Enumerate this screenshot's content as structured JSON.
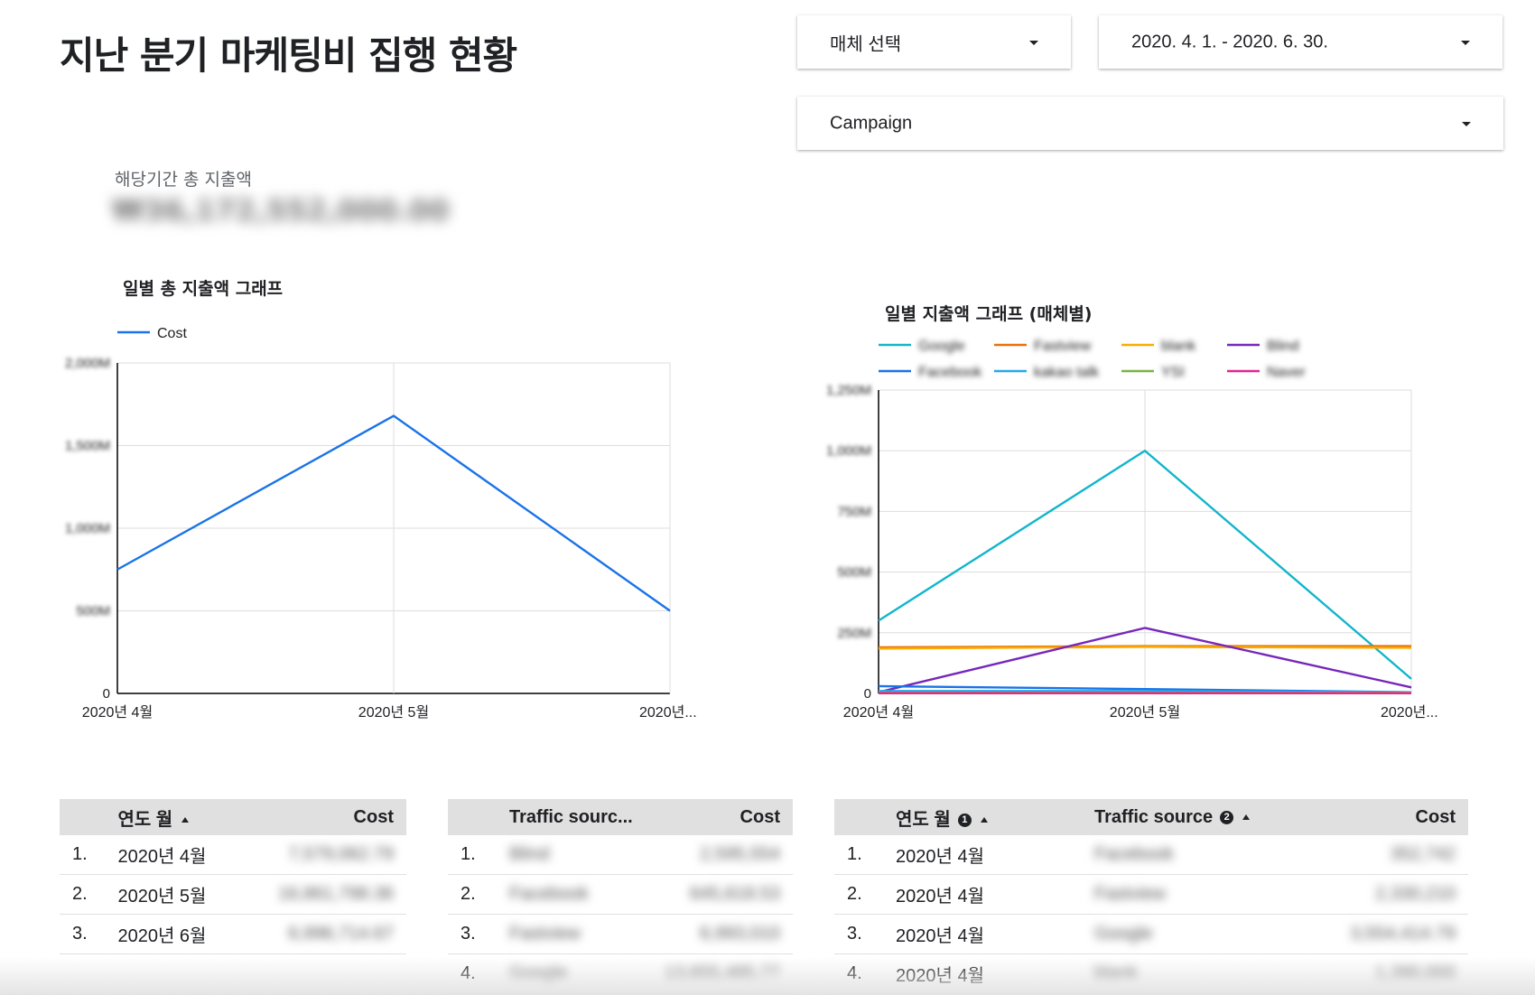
{
  "page_title": "지난 분기 마케팅비 집행 현황",
  "filters": {
    "media_select": "매체 선택",
    "date_range": "2020. 4. 1. - 2020. 6. 30.",
    "campaign": "Campaign"
  },
  "kpi": {
    "label": "해당기간 총 지출액",
    "value": "₩36,172,552,000.00"
  },
  "chart_data": [
    {
      "type": "line",
      "title": "일별 총 지출액 그래프",
      "categories": [
        "2020년 4월",
        "2020년 5월",
        "2020년..."
      ],
      "series": [
        {
          "name": "Cost",
          "color": "#1a73e8",
          "values": [
            750000000,
            1680000000,
            500000000
          ]
        }
      ],
      "y_tick_labels": [
        "0",
        "500M",
        "1,000M",
        "1,500M",
        "2,000M"
      ],
      "ylim": [
        0,
        2000000000
      ],
      "grid": true,
      "legend": "top-left"
    },
    {
      "type": "line",
      "title": "일별 지출액 그래프 (매체별)",
      "categories": [
        "2020년 4월",
        "2020년 5월",
        "2020년..."
      ],
      "series": [
        {
          "name": "Google",
          "color": "#12b5cb",
          "values": [
            300,
            1000,
            60
          ]
        },
        {
          "name": "Fastview",
          "color": "#e8710a",
          "values": [
            190,
            195,
            195
          ]
        },
        {
          "name": "blank",
          "color": "#f9ab00",
          "values": [
            185,
            192,
            188
          ]
        },
        {
          "name": "Blind",
          "color": "#7627bb",
          "values": [
            5,
            270,
            25
          ]
        },
        {
          "name": "Facebook",
          "color": "#1a73e8",
          "values": [
            30,
            18,
            5
          ]
        },
        {
          "name": "kakao talk",
          "color": "#28a8e8",
          "values": [
            10,
            10,
            5
          ]
        },
        {
          "name": "YSI",
          "color": "#7cb342",
          "values": [
            3,
            3,
            3
          ]
        },
        {
          "name": "Naver",
          "color": "#e52592",
          "values": [
            1,
            1,
            1
          ]
        }
      ],
      "y_tick_labels": [
        "0",
        "250M",
        "500M",
        "750M",
        "1,000M",
        "1,250M"
      ],
      "ylim": [
        0,
        1250
      ],
      "grid": true,
      "legend": "top"
    }
  ],
  "table1": {
    "headers": [
      "연도 월",
      "Cost"
    ],
    "rows": [
      {
        "n": "1.",
        "month": "2020년 4월",
        "cost": "7,579,062.79"
      },
      {
        "n": "2.",
        "month": "2020년 5월",
        "cost": "16,861,798.36"
      },
      {
        "n": "3.",
        "month": "2020년 6월",
        "cost": "6,996,714.67"
      }
    ]
  },
  "table2": {
    "headers": [
      "Traffic sourc...",
      "Cost"
    ],
    "rows": [
      {
        "n": "1.",
        "source": "Blind",
        "cost": "2,595,554"
      },
      {
        "n": "2.",
        "source": "Facebook",
        "cost": "645,618.53"
      },
      {
        "n": "3.",
        "source": "Fastview",
        "cost": "6,993,010"
      },
      {
        "n": "4.",
        "source": "Google",
        "cost": "13,655,485.77"
      }
    ]
  },
  "table3": {
    "headers": [
      "연도 월",
      "Traffic source",
      "Cost"
    ],
    "info_marks": [
      "1",
      "2"
    ],
    "rows": [
      {
        "n": "1.",
        "month": "2020년 4월",
        "source": "Facebook",
        "cost": "352,742"
      },
      {
        "n": "2.",
        "month": "2020년 4월",
        "source": "Fastview",
        "cost": "2,330,210"
      },
      {
        "n": "3.",
        "month": "2020년 4월",
        "source": "Google",
        "cost": "3,554,414.79"
      },
      {
        "n": "4.",
        "month": "2020년 4월",
        "source": "blank",
        "cost": "1,390,000"
      }
    ]
  }
}
